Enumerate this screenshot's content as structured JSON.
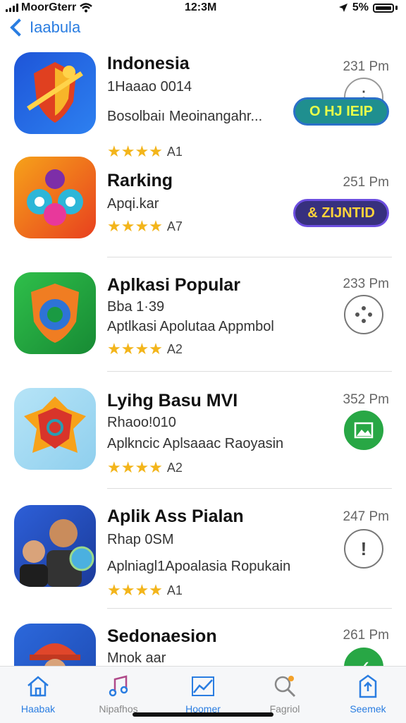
{
  "status_bar": {
    "carrier": "MoorGterr",
    "time": "12:3M",
    "battery": "5%"
  },
  "nav": {
    "back_label": "Iaabula"
  },
  "apps": [
    {
      "title": "Indonesia",
      "subtitle": "1Haaao 0014",
      "desc": "Bosolbaiı Meoinangahr...",
      "rating": "★★★★",
      "count": "A1",
      "time": "231 Pm",
      "action": "pill-a",
      "pill_label": "O HJ IEIP"
    },
    {
      "title": "Rarking",
      "subtitle": "Apqi.kar",
      "desc": "",
      "rating": "★★★★",
      "count": "A7",
      "time": "251 Pm",
      "action": "pill-b",
      "pill_label": "& ZIJNTID"
    },
    {
      "title": "Aplkasi Popular",
      "subtitle": "Bba 1·39",
      "desc": "Aptlkasi  Apolutaa Appmbol",
      "rating": "★★★★",
      "count": "A2",
      "time": "233 Pm",
      "action": "loading"
    },
    {
      "title": "Lyihg Basu MVI",
      "subtitle": "Rhaoo!010",
      "desc": "Aplkncic Aplsaaac Raoyasin",
      "rating": "★★★★",
      "count": "A2",
      "time": "352 Pm",
      "action": "green"
    },
    {
      "title": "Aplik Ass Pialan",
      "subtitle": "Rhap 0SM",
      "desc": "Aplniagl1Apoalasia Ropukain",
      "rating": "★★★★",
      "count": "A1",
      "time": "247 Pm",
      "action": "alert"
    },
    {
      "title": "Sedonaesion",
      "subtitle": "Mnok aar",
      "desc": "",
      "rating": "",
      "count": "",
      "time": "261 Pm",
      "action": "green"
    }
  ],
  "tabs": [
    {
      "label": "Haabak",
      "icon": "home-icon"
    },
    {
      "label": "Nipafhos",
      "icon": "music-icon"
    },
    {
      "label": "Hoomer",
      "icon": "chart-icon"
    },
    {
      "label": "Fagriol",
      "icon": "search-icon"
    },
    {
      "label": "Seemek",
      "icon": "upload-icon"
    }
  ]
}
